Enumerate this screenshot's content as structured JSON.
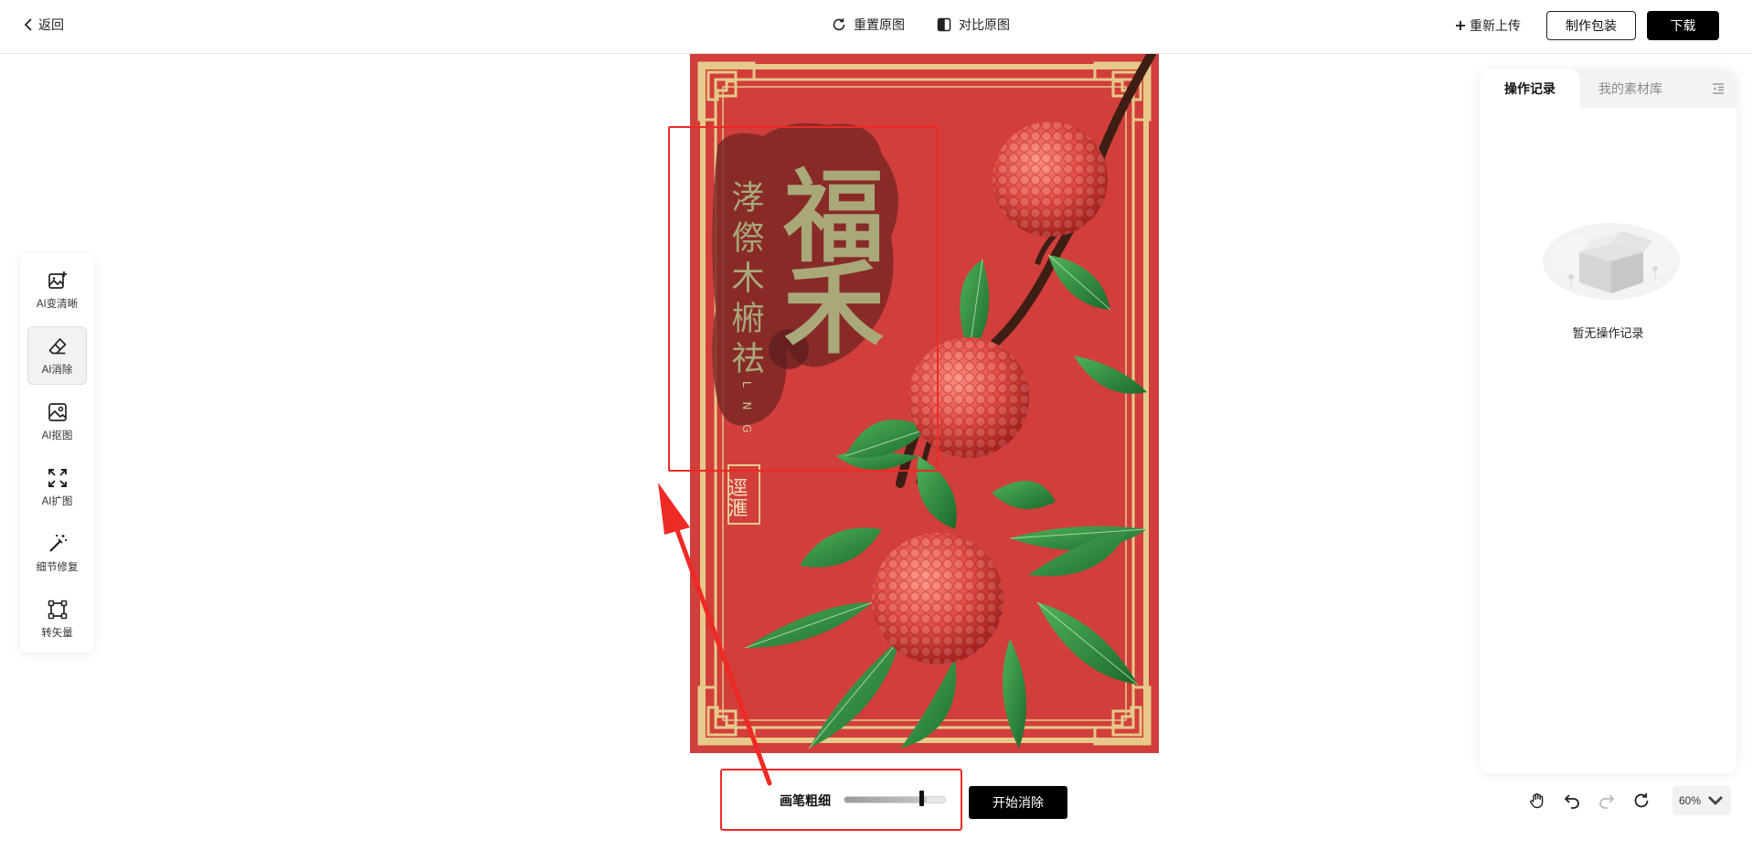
{
  "topbar": {
    "back_label": "返回",
    "reset_label": "重置原图",
    "compare_label": "对比原图",
    "reupload_label": "重新上传",
    "make_package_label": "制作包装",
    "download_label": "下载"
  },
  "left_tools": [
    {
      "label": "AI变清晰",
      "icon": "image-enhance-icon",
      "active": false
    },
    {
      "label": "AI消除",
      "icon": "eraser-icon",
      "active": true
    },
    {
      "label": "AI抠图",
      "icon": "image-cutout-icon",
      "active": false
    },
    {
      "label": "AI扩图",
      "icon": "expand-icon",
      "active": false
    },
    {
      "label": "细节修复",
      "icon": "magic-wand-icon",
      "active": false
    },
    {
      "label": "转矢量",
      "icon": "vector-icon",
      "active": false
    }
  ],
  "poster": {
    "vertical_text": "涍傺木椨祛",
    "big_chars": "福禾",
    "small_latin": "L N G",
    "seal_text": "逕滙",
    "colors": {
      "background": "#cf3c3a",
      "gold": "#e6c98a",
      "leaf": "#2f8a3e",
      "fruit": "#e8554c"
    }
  },
  "brush": {
    "label": "画笔粗细",
    "value_percent": 78,
    "start_label": "开始消除"
  },
  "right_panel": {
    "tabs": [
      "操作记录",
      "我的素材库"
    ],
    "active_tab": 0,
    "empty_text": "暂无操作记录"
  },
  "zoom": {
    "value": "60%"
  },
  "annotation_color": "#ee2a24"
}
